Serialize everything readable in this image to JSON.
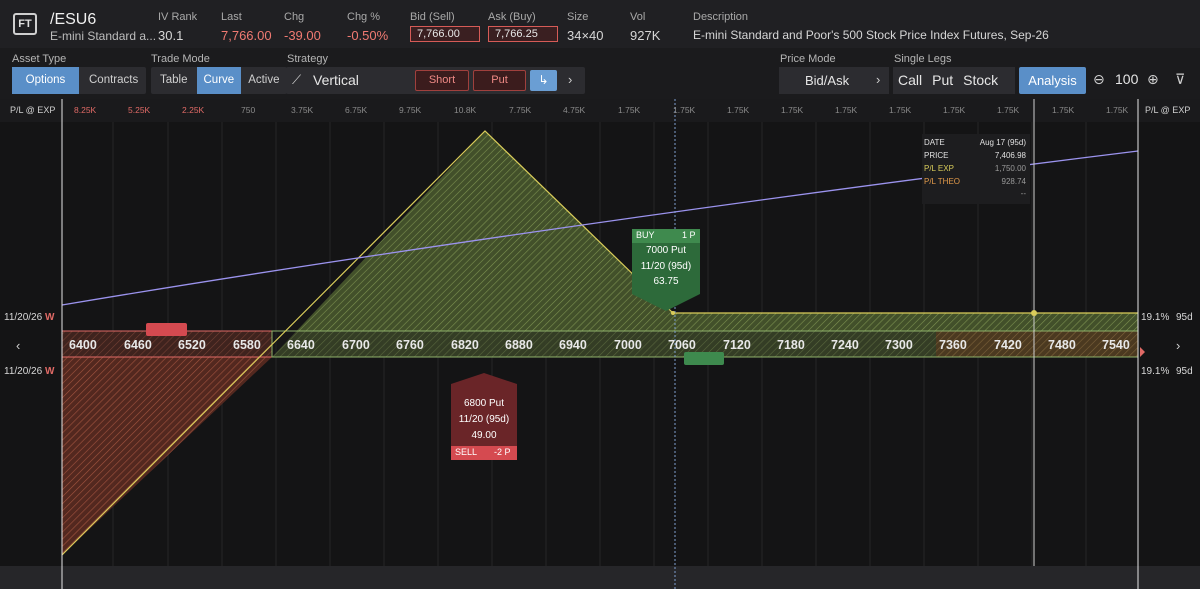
{
  "header": {
    "logo": "FT",
    "symbol": "/ESU6",
    "symbol_desc": "E-mini Standard a...",
    "fields": [
      {
        "label": "IV Rank",
        "value": "30.1"
      },
      {
        "label": "Last",
        "value": "7,766.00"
      },
      {
        "label": "Chg",
        "value": "-39.00"
      },
      {
        "label": "Chg %",
        "value": "-0.50%"
      },
      {
        "label": "Bid (Sell)",
        "value": "7,766.00"
      },
      {
        "label": "Ask (Buy)",
        "value": "7,766.25"
      },
      {
        "label": "Size",
        "value": "34×40"
      },
      {
        "label": "Vol",
        "value": "927K"
      },
      {
        "label": "Description",
        "value": "E-mini Standard and Poor's 500 Stock Price Index Futures, Sep-26"
      }
    ]
  },
  "toolbar": {
    "asset_type_label": "Asset Type",
    "asset_options": "Options",
    "asset_contracts": "Contracts",
    "trade_mode_label": "Trade Mode",
    "mode_table": "Table",
    "mode_curve": "Curve",
    "mode_active": "Active",
    "strategy_label": "Strategy",
    "strategy_name": "Vertical",
    "short_label": "Short",
    "put_label": "Put",
    "swap_icon": "↳",
    "next_icon": "›",
    "price_mode_label": "Price Mode",
    "price_mode_value": "Bid/Ask",
    "single_legs_label": "Single Legs",
    "leg_call": "Call",
    "leg_put": "Put",
    "leg_stock": "Stock",
    "analysis_label": "Analysis",
    "zoom_value": "100"
  },
  "plot": {
    "axis_left_label": "P/L @ EXP",
    "axis_right_label": "P/L @ EXP",
    "top_values": [
      "8.25K",
      "5.25K",
      "2.25K",
      "750",
      "3.75K",
      "6.75K",
      "9.75K",
      "10.8K",
      "7.75K",
      "4.75K",
      "1.75K",
      "1.75K",
      "1.75K",
      "1.75K",
      "1.75K",
      "1.75K",
      "1.75K",
      "1.75K",
      "1.75K",
      "1.75K"
    ],
    "strikes": [
      "6400",
      "6460",
      "6520",
      "6580",
      "6640",
      "6700",
      "6760",
      "6820",
      "6880",
      "6940",
      "7000",
      "7060",
      "7120",
      "7180",
      "7240",
      "7300",
      "7360",
      "7420",
      "7480",
      "7540"
    ],
    "left_date_top": "11/20/26",
    "left_date_bottom": "11/20/26",
    "w_marker": "W",
    "right_iv_top": "19.1%",
    "right_iv_bottom": "19.1%",
    "right_days_top": "95d",
    "right_days_bottom": "95d",
    "prev_arrow": "‹",
    "next_arrow": "›"
  },
  "tooltip": {
    "date_label": "DATE",
    "date_value": "Aug 17 (95d)",
    "price_label": "PRICE",
    "price_value": "7,406.98",
    "plexp_label": "P/L EXP",
    "plexp_value": "1,750.00",
    "pltheo_label": "P/L THEO",
    "pltheo_value": "928.74",
    "extra_value": "--"
  },
  "buy_leg": {
    "side": "BUY",
    "qty": "1 P",
    "title": "7000 Put",
    "expiry": "11/20 (95d)",
    "price": "63.75"
  },
  "sell_leg": {
    "title": "6800 Put",
    "expiry": "11/20 (95d)",
    "price": "49.00",
    "side": "SELL",
    "qty": "-2 P"
  },
  "colors": {
    "accent_blue": "#5a8fc8",
    "profit_green": "#9dbf6a",
    "loss_red": "#e06a66",
    "theo_purple": "#8f87e8",
    "orange": "#e29a4a"
  }
}
